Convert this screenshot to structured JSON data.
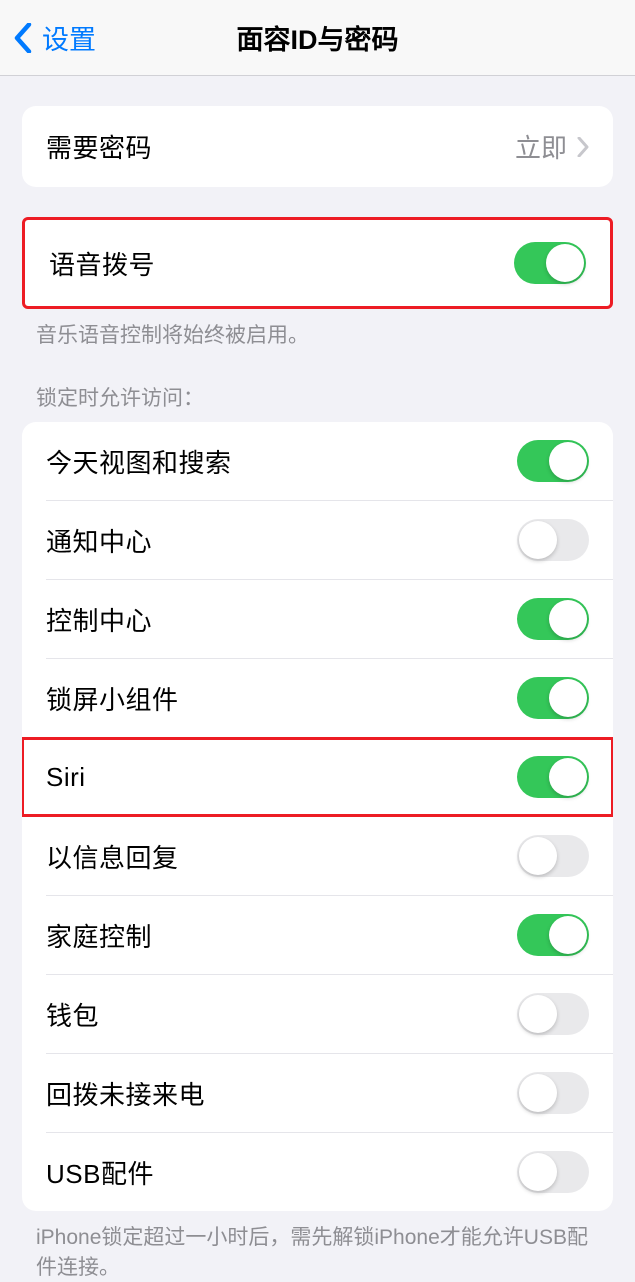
{
  "header": {
    "back_label": "设置",
    "title": "面容ID与密码"
  },
  "require_passcode": {
    "label": "需要密码",
    "value": "立即"
  },
  "voice_dial": {
    "label": "语音拨号",
    "on": true,
    "footer": "音乐语音控制将始终被启用。"
  },
  "lock_section": {
    "header": "锁定时允许访问：",
    "items": [
      {
        "label": "今天视图和搜索",
        "on": true
      },
      {
        "label": "通知中心",
        "on": false
      },
      {
        "label": "控制中心",
        "on": true
      },
      {
        "label": "锁屏小组件",
        "on": true
      },
      {
        "label": "Siri",
        "on": true
      },
      {
        "label": "以信息回复",
        "on": false
      },
      {
        "label": "家庭控制",
        "on": true
      },
      {
        "label": "钱包",
        "on": false
      },
      {
        "label": "回拨未接来电",
        "on": false
      },
      {
        "label": "USB配件",
        "on": false
      }
    ],
    "footer": "iPhone锁定超过一小时后，需先解锁iPhone才能允许USB配件连接。"
  }
}
